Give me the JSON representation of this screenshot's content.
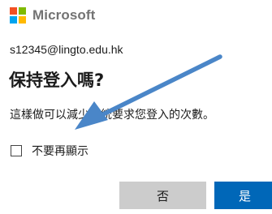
{
  "brand": {
    "name": "Microsoft",
    "colors": {
      "red": "#f25022",
      "green": "#7fba00",
      "blue": "#00a4ef",
      "yellow": "#ffb900"
    }
  },
  "account": {
    "identity": "s12345@lingto.edu.hk"
  },
  "prompt": {
    "title": "保持登入嗎?",
    "description": "這樣做可以減少系統要求您登入的次數。"
  },
  "checkbox": {
    "label": "不要再顯示",
    "checked": false
  },
  "buttons": {
    "no_label": "否",
    "yes_label": "是"
  },
  "annotation": {
    "icon": "arrow-icon",
    "color": "#4a86c8"
  }
}
